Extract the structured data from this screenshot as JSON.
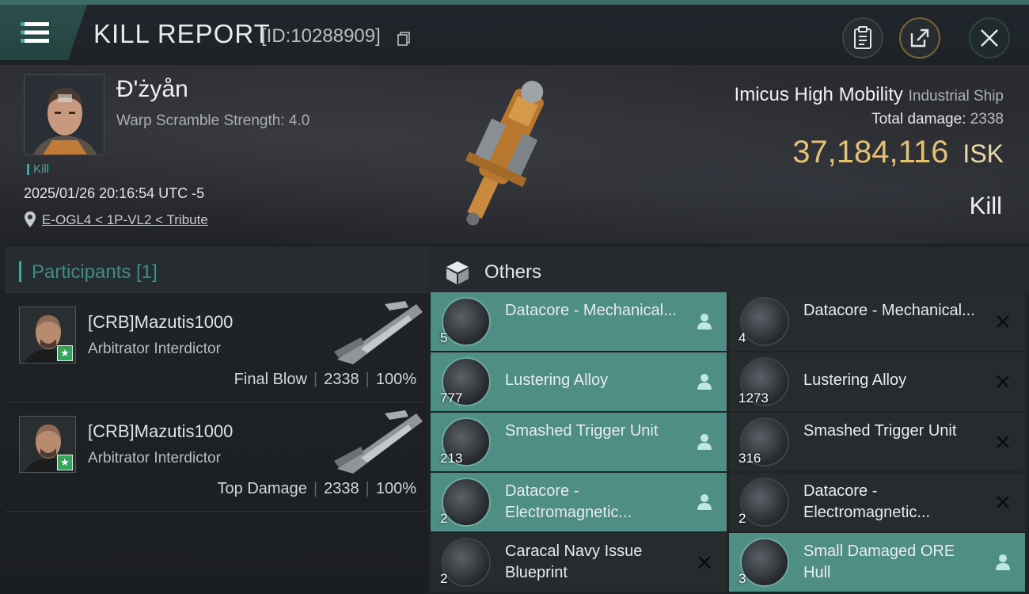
{
  "header": {
    "title": "KILL REPORT",
    "kill_id": "[ID:10288909]",
    "icons": [
      "menu-icon",
      "copy-icon",
      "clipboard-icon",
      "share-icon",
      "close-icon"
    ]
  },
  "victim": {
    "name": "Đ'żyån",
    "warp_scramble": "Warp Scramble Strength: 4.0",
    "tag": "Kill",
    "timestamp": "2025/01/26 20:16:54 UTC -5",
    "location": "E-OGL4 < 1P-VL2 < Tribute"
  },
  "ship": {
    "name": "Imicus High Mobility",
    "class": "Industrial Ship",
    "total_damage_label": "Total damage:",
    "total_damage": "2338",
    "isk_value": "37,184,116",
    "isk_unit": "ISK",
    "result": "Kill"
  },
  "participants": {
    "title": "Participants [1]",
    "rows": [
      {
        "name": "[CRB]Mazutis1000",
        "ship": "Arbitrator Interdictor",
        "role": "Final Blow",
        "damage": "2338",
        "percent": "100%"
      },
      {
        "name": "[CRB]Mazutis1000",
        "ship": "Arbitrator Interdictor",
        "role": "Top Damage",
        "damage": "2338",
        "percent": "100%"
      }
    ]
  },
  "others": {
    "title": "Others",
    "items": [
      {
        "name": "Datacore - Mechanical...",
        "qty": "5",
        "status": "dropped"
      },
      {
        "name": "Datacore - Mechanical...",
        "qty": "4",
        "status": "destroyed"
      },
      {
        "name": "Lustering Alloy",
        "qty": "777",
        "status": "dropped"
      },
      {
        "name": "Lustering Alloy",
        "qty": "1273",
        "status": "destroyed"
      },
      {
        "name": "Smashed Trigger Unit",
        "qty": "213",
        "status": "dropped"
      },
      {
        "name": "Smashed Trigger Unit",
        "qty": "316",
        "status": "destroyed"
      },
      {
        "name": "Datacore - Electromagnetic...",
        "qty": "2",
        "status": "dropped"
      },
      {
        "name": "Datacore - Electromagnetic...",
        "qty": "2",
        "status": "destroyed"
      },
      {
        "name": "Caracal Navy Issue Blueprint",
        "qty": "2",
        "status": "destroyed"
      },
      {
        "name": "Small Damaged ORE Hull",
        "qty": "3",
        "status": "dropped"
      }
    ]
  },
  "colors": {
    "accent_teal": "#4ca39b",
    "dropped_row": "#4f8e84",
    "isk_gold": "#e4c274"
  }
}
